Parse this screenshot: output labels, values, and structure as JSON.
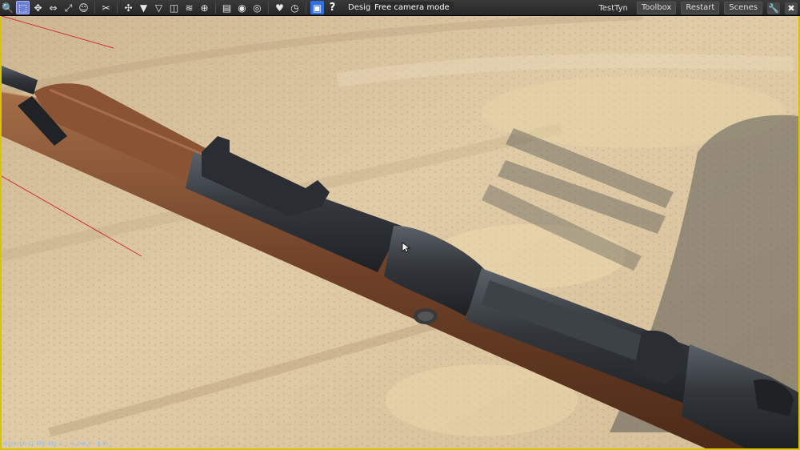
{
  "toolbar": {
    "tools": [
      {
        "name": "magnify-icon",
        "glyph": "🔍"
      },
      {
        "name": "select-icon",
        "glyph": "⬚",
        "active": true
      },
      {
        "name": "move-icon",
        "glyph": "✥"
      },
      {
        "name": "rotate-icon",
        "glyph": "⇔"
      },
      {
        "name": "scale-icon",
        "glyph": "⤢"
      },
      {
        "name": "smiley-icon",
        "glyph": "☺"
      },
      {
        "name": "cut-icon",
        "glyph": "✂"
      },
      {
        "name": "snap-icon",
        "glyph": "✣"
      },
      {
        "name": "ground-align-icon",
        "glyph": "▼"
      },
      {
        "name": "filter-icon",
        "glyph": "▽"
      },
      {
        "name": "split-view-icon",
        "glyph": "◫"
      },
      {
        "name": "terrain-icon",
        "glyph": "≋"
      },
      {
        "name": "crosshair-icon",
        "glyph": "⊕"
      },
      {
        "name": "document-icon",
        "glyph": "▤"
      },
      {
        "name": "visibility-icon",
        "glyph": "◉"
      },
      {
        "name": "eye-icon",
        "glyph": "◎"
      },
      {
        "name": "heart-icon",
        "glyph": "♥"
      },
      {
        "name": "timer-icon",
        "glyph": "◷"
      },
      {
        "name": "save-icon",
        "glyph": "▣"
      },
      {
        "name": "help-icon",
        "glyph": "?"
      }
    ],
    "mode_label": "Designer",
    "mode_caret": "▾",
    "camera_mode": "Free camera mode",
    "user": "TestTyn",
    "toolbox": "Toolbox",
    "restart": "Restart",
    "scenes": "Scenes",
    "wrench_glyph": "🔧",
    "close_glyph": "✖"
  },
  "viewport": {
    "status_text": "DirectX 11 FPS:152.2 ( 6.2+8.9 -8.6)",
    "accent_color": "#d9c400",
    "sand_color": "#d9c3a0",
    "wood_color": "#7a4a2c",
    "metal_color": "#2f3338"
  }
}
